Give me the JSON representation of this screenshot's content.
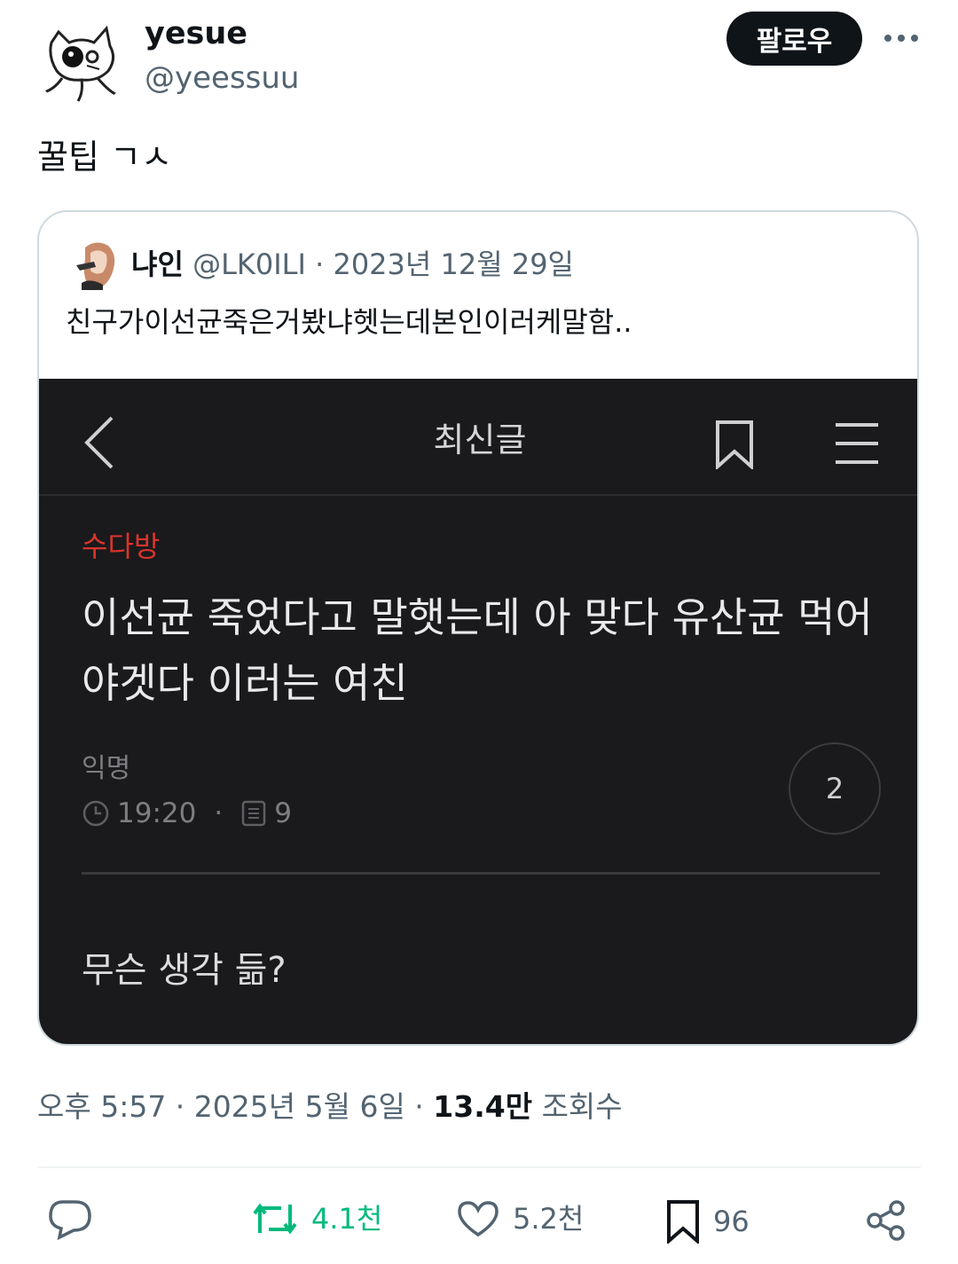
{
  "author": {
    "name": "yesue",
    "handle": "@yeessuu",
    "follow_label": "팔로우"
  },
  "tweet": {
    "text": "꿀팁 ㄱㅅ"
  },
  "quote": {
    "name": "냐인",
    "handle": "@LK0ILI",
    "separator": "·",
    "date": "2023년 12월 29일",
    "text": "친구가이선균죽은거봤냐헷는데본인이러케말함..",
    "screenshot": {
      "title": "최신글",
      "category": "수다방",
      "headline": "이선균 죽었다고 말햇는데 아 맞다 유산균 먹어야겟다 이러는 여친",
      "author": "익명",
      "time": "19:20",
      "meta_dot": "·",
      "views": "9",
      "comments": "2",
      "question": "무슨 생각 듦?"
    }
  },
  "footer": {
    "time_date": "오후 5:57 · 2025년 5월 6일 · ",
    "views_count": "13.4만",
    "views_label": " 조회수"
  },
  "actions": {
    "retweets": "4.1천",
    "likes": "5.2천",
    "bookmarks": "96"
  },
  "colors": {
    "retweet_green": "#00ba7c",
    "category_red": "#d9342b",
    "follow_bg": "#0f1419",
    "secondary_text": "#536471"
  }
}
